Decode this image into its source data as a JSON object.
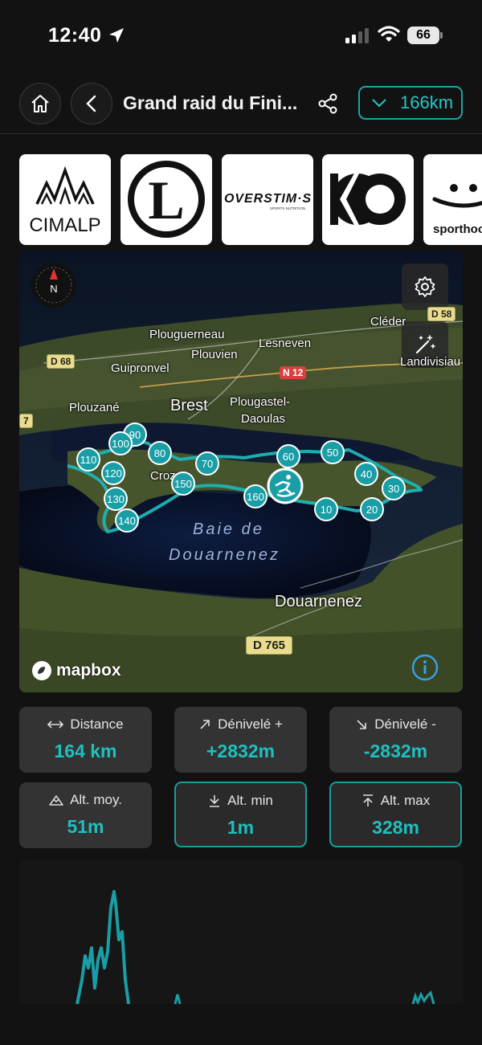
{
  "status_bar": {
    "time": "12:40",
    "battery": "66"
  },
  "header": {
    "title": "Grand raid du Fini...",
    "distance_label": "166km"
  },
  "sponsors": [
    {
      "name": "CIMALP",
      "icon": "cimalp-logo"
    },
    {
      "name": "L",
      "icon": "leclerc-logo"
    },
    {
      "name": "OVERSTIM·S",
      "sub": "SPORTS NUTRITION",
      "icon": "overstims-logo"
    },
    {
      "name": "",
      "icon": "ko-logo"
    },
    {
      "name": "sporthoo",
      "icon": "sporthoo-logo"
    }
  ],
  "map": {
    "places": {
      "plouguerneau": "Plouguerneau",
      "plouvien": "Plouvien",
      "lesneven": "Lesneven",
      "cleder": "Cléder",
      "landivisiau": "Landivisiau",
      "guipronvel": "Guipronvel",
      "plouzane": "Plouzané",
      "brest": "Brest",
      "plougastel": "Plougastel-",
      "daoulas": "Daoulas",
      "crozon": "Crozon",
      "douarnenez": "Douarnenez"
    },
    "bay": [
      "Baie de",
      "Douarnenez"
    ],
    "roads": {
      "d68": "D 68",
      "n12": "N 12",
      "d58": "D 58",
      "d765": "D 765",
      "d7": "7"
    },
    "markers": [
      "10",
      "20",
      "30",
      "40",
      "50",
      "60",
      "70",
      "80",
      "90",
      "100",
      "110",
      "120",
      "130",
      "140",
      "150",
      "160"
    ],
    "attribution": "mapbox",
    "accent": "#1a9ea6"
  },
  "stats": [
    {
      "label": "Distance",
      "value": "164 km",
      "icon": "arrows-horizontal-icon"
    },
    {
      "label": "Dénivelé +",
      "value": "+2832m",
      "icon": "arrow-up-right-icon"
    },
    {
      "label": "Dénivelé -",
      "value": "-2832m",
      "icon": "arrow-down-right-icon"
    },
    {
      "label": "Alt. moy.",
      "value": "51m",
      "icon": "mountain-icon"
    },
    {
      "label": "Alt. min",
      "value": "1m",
      "icon": "arrow-down-bar-icon"
    },
    {
      "label": "Alt. max",
      "value": "328m",
      "icon": "arrow-up-bar-icon"
    }
  ],
  "colors": {
    "accent": "#1ec0c0",
    "background": "#121212",
    "card": "#333333"
  }
}
